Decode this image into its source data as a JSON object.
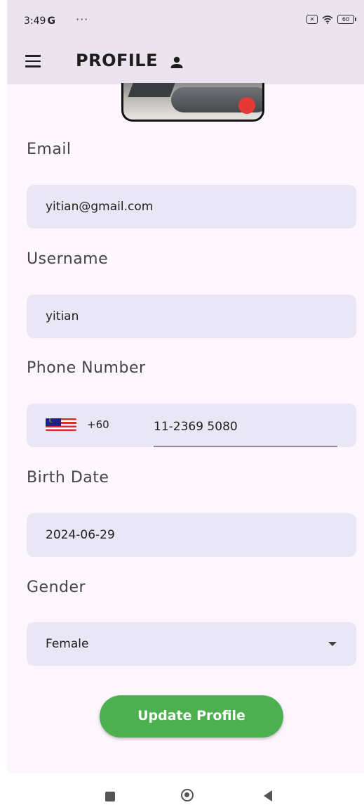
{
  "status_bar": {
    "time": "3:49",
    "network": "G",
    "dots": "···",
    "battery": "60"
  },
  "app_bar": {
    "title": "PROFILE"
  },
  "form": {
    "email": {
      "label": "Email",
      "value": "yitian@gmail.com"
    },
    "username": {
      "label": "Username",
      "value": "yitian"
    },
    "phone": {
      "label": "Phone Number",
      "country_code": "+60",
      "value": "11-2369 5080"
    },
    "birth_date": {
      "label": "Birth Date",
      "value": "2024-06-29"
    },
    "gender": {
      "label": "Gender",
      "value": "Female"
    }
  },
  "actions": {
    "update_label": "Update Profile"
  },
  "colors": {
    "app_bar_bg": "#ebe3ee",
    "screen_bg": "#fdf6fd",
    "field_bg": "#e9e7f5",
    "button_bg": "#4caf50",
    "avatar_badge": "#e53935"
  }
}
